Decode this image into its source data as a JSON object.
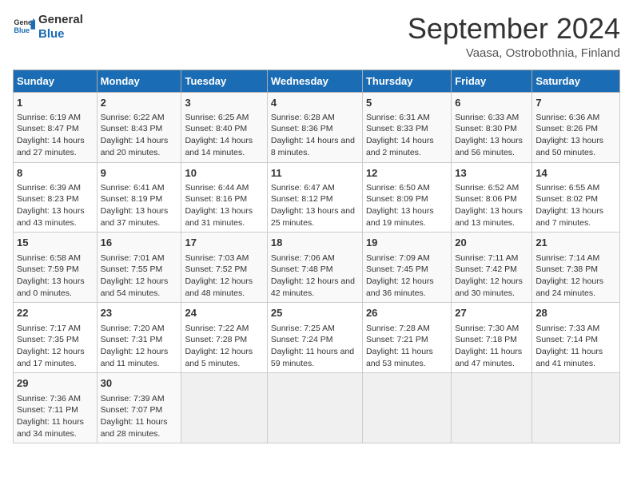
{
  "header": {
    "logo_text_general": "General",
    "logo_text_blue": "Blue",
    "title": "September 2024",
    "subtitle": "Vaasa, Ostrobothnia, Finland"
  },
  "days_of_week": [
    "Sunday",
    "Monday",
    "Tuesday",
    "Wednesday",
    "Thursday",
    "Friday",
    "Saturday"
  ],
  "weeks": [
    [
      {
        "day": "1",
        "sunrise": "6:19 AM",
        "sunset": "8:47 PM",
        "daylight": "14 hours and 27 minutes."
      },
      {
        "day": "2",
        "sunrise": "6:22 AM",
        "sunset": "8:43 PM",
        "daylight": "14 hours and 20 minutes."
      },
      {
        "day": "3",
        "sunrise": "6:25 AM",
        "sunset": "8:40 PM",
        "daylight": "14 hours and 14 minutes."
      },
      {
        "day": "4",
        "sunrise": "6:28 AM",
        "sunset": "8:36 PM",
        "daylight": "14 hours and 8 minutes."
      },
      {
        "day": "5",
        "sunrise": "6:31 AM",
        "sunset": "8:33 PM",
        "daylight": "14 hours and 2 minutes."
      },
      {
        "day": "6",
        "sunrise": "6:33 AM",
        "sunset": "8:30 PM",
        "daylight": "13 hours and 56 minutes."
      },
      {
        "day": "7",
        "sunrise": "6:36 AM",
        "sunset": "8:26 PM",
        "daylight": "13 hours and 50 minutes."
      }
    ],
    [
      {
        "day": "8",
        "sunrise": "6:39 AM",
        "sunset": "8:23 PM",
        "daylight": "13 hours and 43 minutes."
      },
      {
        "day": "9",
        "sunrise": "6:41 AM",
        "sunset": "8:19 PM",
        "daylight": "13 hours and 37 minutes."
      },
      {
        "day": "10",
        "sunrise": "6:44 AM",
        "sunset": "8:16 PM",
        "daylight": "13 hours and 31 minutes."
      },
      {
        "day": "11",
        "sunrise": "6:47 AM",
        "sunset": "8:12 PM",
        "daylight": "13 hours and 25 minutes."
      },
      {
        "day": "12",
        "sunrise": "6:50 AM",
        "sunset": "8:09 PM",
        "daylight": "13 hours and 19 minutes."
      },
      {
        "day": "13",
        "sunrise": "6:52 AM",
        "sunset": "8:06 PM",
        "daylight": "13 hours and 13 minutes."
      },
      {
        "day": "14",
        "sunrise": "6:55 AM",
        "sunset": "8:02 PM",
        "daylight": "13 hours and 7 minutes."
      }
    ],
    [
      {
        "day": "15",
        "sunrise": "6:58 AM",
        "sunset": "7:59 PM",
        "daylight": "13 hours and 0 minutes."
      },
      {
        "day": "16",
        "sunrise": "7:01 AM",
        "sunset": "7:55 PM",
        "daylight": "12 hours and 54 minutes."
      },
      {
        "day": "17",
        "sunrise": "7:03 AM",
        "sunset": "7:52 PM",
        "daylight": "12 hours and 48 minutes."
      },
      {
        "day": "18",
        "sunrise": "7:06 AM",
        "sunset": "7:48 PM",
        "daylight": "12 hours and 42 minutes."
      },
      {
        "day": "19",
        "sunrise": "7:09 AM",
        "sunset": "7:45 PM",
        "daylight": "12 hours and 36 minutes."
      },
      {
        "day": "20",
        "sunrise": "7:11 AM",
        "sunset": "7:42 PM",
        "daylight": "12 hours and 30 minutes."
      },
      {
        "day": "21",
        "sunrise": "7:14 AM",
        "sunset": "7:38 PM",
        "daylight": "12 hours and 24 minutes."
      }
    ],
    [
      {
        "day": "22",
        "sunrise": "7:17 AM",
        "sunset": "7:35 PM",
        "daylight": "12 hours and 17 minutes."
      },
      {
        "day": "23",
        "sunrise": "7:20 AM",
        "sunset": "7:31 PM",
        "daylight": "12 hours and 11 minutes."
      },
      {
        "day": "24",
        "sunrise": "7:22 AM",
        "sunset": "7:28 PM",
        "daylight": "12 hours and 5 minutes."
      },
      {
        "day": "25",
        "sunrise": "7:25 AM",
        "sunset": "7:24 PM",
        "daylight": "11 hours and 59 minutes."
      },
      {
        "day": "26",
        "sunrise": "7:28 AM",
        "sunset": "7:21 PM",
        "daylight": "11 hours and 53 minutes."
      },
      {
        "day": "27",
        "sunrise": "7:30 AM",
        "sunset": "7:18 PM",
        "daylight": "11 hours and 47 minutes."
      },
      {
        "day": "28",
        "sunrise": "7:33 AM",
        "sunset": "7:14 PM",
        "daylight": "11 hours and 41 minutes."
      }
    ],
    [
      {
        "day": "29",
        "sunrise": "7:36 AM",
        "sunset": "7:11 PM",
        "daylight": "11 hours and 34 minutes."
      },
      {
        "day": "30",
        "sunrise": "7:39 AM",
        "sunset": "7:07 PM",
        "daylight": "11 hours and 28 minutes."
      },
      null,
      null,
      null,
      null,
      null
    ]
  ]
}
